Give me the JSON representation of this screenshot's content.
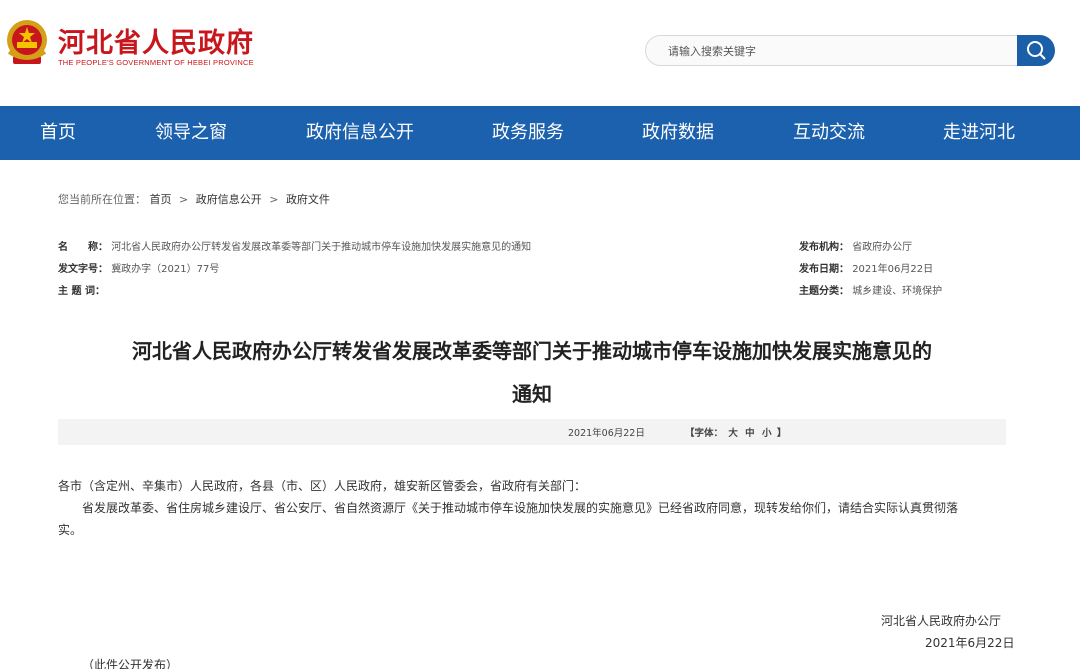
{
  "header": {
    "site_title": "河北省人民政府",
    "site_subtitle": "THE PEOPLE'S GOVERNMENT OF HEBEI PROVINCE"
  },
  "search": {
    "placeholder": "请输入搜索关键字",
    "icon": "search-icon"
  },
  "nav": {
    "items": [
      {
        "label": "首页"
      },
      {
        "label": "领导之窗"
      },
      {
        "label": "政府信息公开"
      },
      {
        "label": "政务服务"
      },
      {
        "label": "政府数据"
      },
      {
        "label": "互动交流"
      },
      {
        "label": "走进河北"
      }
    ]
  },
  "breadcrumb": {
    "prefix": "您当前所在位置：",
    "items": [
      "首页",
      "政府信息公开",
      "政府文件"
    ],
    "separator": ">"
  },
  "meta": {
    "name_label": "名　　称：",
    "name_value": "河北省人民政府办公厅转发省发展改革委等部门关于推动城市停车设施加快发展实施意见的通知",
    "doc_no_label": "发文字号：",
    "doc_no_value": "冀政办字（2021）77号",
    "subject_label": "主 题 词：",
    "subject_value": "",
    "org_label": "发布机构：",
    "org_value": "省政府办公厅",
    "date_label": "发布日期：",
    "date_value": "2021年06月22日",
    "category_label": "主题分类：",
    "category_value": "城乡建设、环境保护"
  },
  "document": {
    "title_line1": "河北省人民政府办公厅转发省发展改革委等部门关于推动城市停车设施加快发展实施意见的",
    "title_line2": "通知",
    "info_date": "2021年06月22日",
    "font_label_open": "【字体：",
    "font_large": "大",
    "font_medium": "中",
    "font_small": "小",
    "font_label_close": "】",
    "salutation": "各市（含定州、辛集市）人民政府，各县（市、区）人民政府，雄安新区管委会，省政府有关部门：",
    "body_line1": "省发展改革委、省住房城乡建设厅、省公安厅、省自然资源厅《关于推动城市停车设施加快发展的实施意见》已经省政府同意，现转发给你们，请结合实际认真贯彻落",
    "body_line2": "实。",
    "signer": "河北省人民政府办公厅",
    "sign_date": "2021年6月22日",
    "publish_note": "（此件公开发布）"
  },
  "colors": {
    "brand_red": "#c8161d",
    "nav_blue": "#1c61ad",
    "search_blue": "#1a5fa8"
  }
}
